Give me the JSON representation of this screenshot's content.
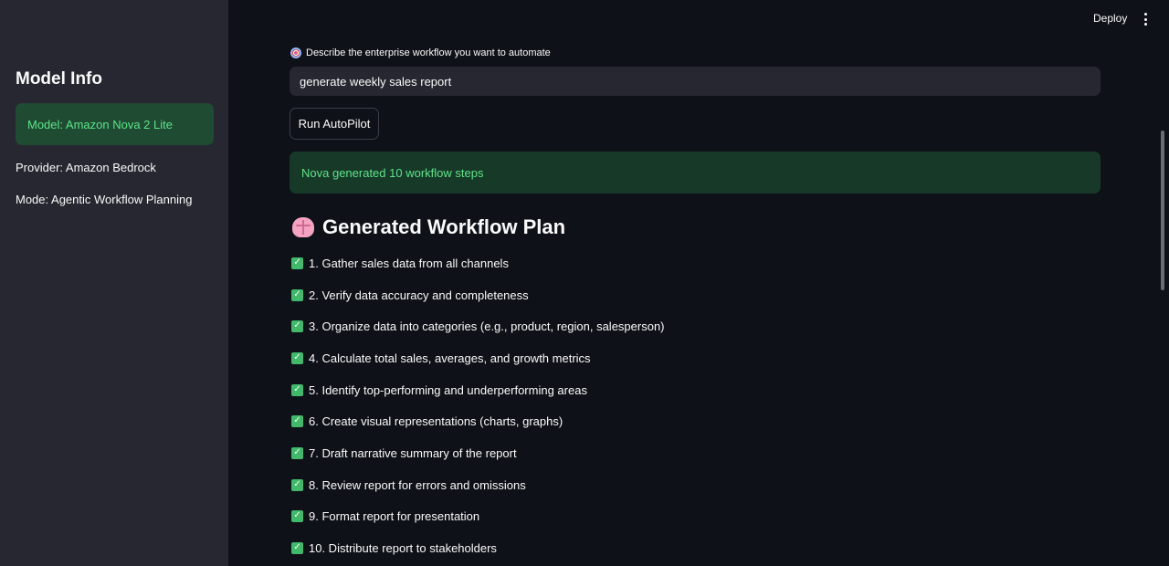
{
  "sidebar": {
    "title": "Model Info",
    "model": "Model: Amazon Nova 2 Lite",
    "provider": "Provider: Amazon Bedrock",
    "mode": "Mode: Agentic Workflow Planning"
  },
  "header": {
    "deploy_label": "Deploy"
  },
  "main": {
    "input_label": "Describe the enterprise workflow you want to automate",
    "input_value": "generate weekly sales report",
    "run_button_label": "Run AutoPilot",
    "success_message": "Nova generated 10 workflow steps",
    "plan_heading": "Generated Workflow Plan",
    "steps": [
      "1. Gather sales data from all channels",
      "2. Verify data accuracy and completeness",
      "3. Organize data into categories (e.g., product, region, salesperson)",
      "4. Calculate total sales, averages, and growth metrics",
      "5. Identify top-performing and underperforming areas",
      "6. Create visual representations (charts, graphs)",
      "7. Draft narrative summary of the report",
      "8. Review report for errors and omissions",
      "9. Format report for presentation",
      "10. Distribute report to stakeholders"
    ]
  },
  "icons": {
    "input_label_icon": "target-icon",
    "heading_icon": "brain-icon",
    "step_icon": "check-icon",
    "menu_icon": "kebab-menu-icon"
  },
  "colors": {
    "sidebar_bg": "#262730",
    "main_bg": "#0e1117",
    "success_bg": "#173928",
    "success_text": "#5ce488",
    "check_green": "#3fb96a"
  }
}
